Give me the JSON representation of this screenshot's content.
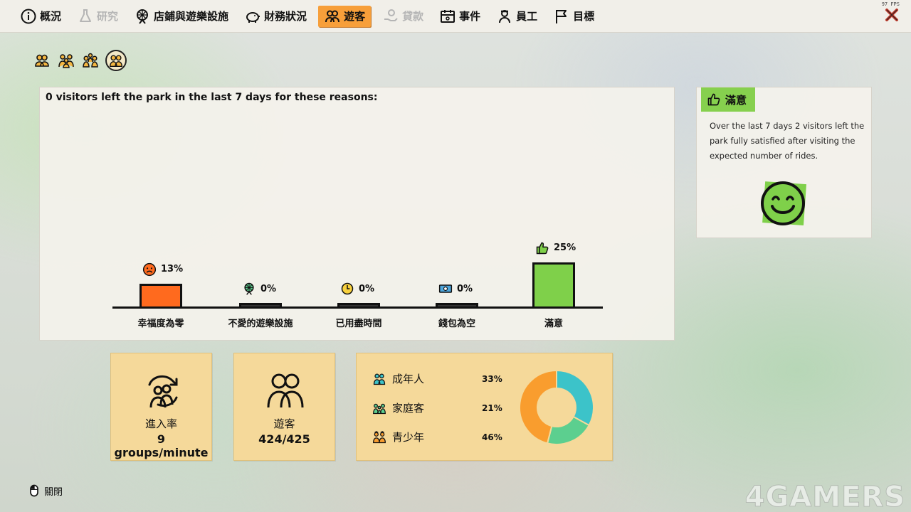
{
  "topbar": {
    "fps": "97 FPS",
    "tabs": [
      {
        "label": "概況",
        "icon": "info-icon",
        "state": "normal"
      },
      {
        "label": "研究",
        "icon": "flask-icon",
        "state": "disabled"
      },
      {
        "label": "店鋪與遊樂設施",
        "icon": "ferris-wheel-icon",
        "state": "normal"
      },
      {
        "label": "財務狀況",
        "icon": "piggy-bank-icon",
        "state": "normal"
      },
      {
        "label": "遊客",
        "icon": "visitors-icon",
        "state": "active"
      },
      {
        "label": "貸款",
        "icon": "loan-hand-icon",
        "state": "disabled"
      },
      {
        "label": "事件",
        "icon": "calendar-icon",
        "state": "normal"
      },
      {
        "label": "員工",
        "icon": "staff-icon",
        "state": "normal"
      },
      {
        "label": "目標",
        "icon": "flag-icon",
        "state": "normal"
      }
    ],
    "accent": "#f79f3a"
  },
  "subtabs": [
    "visitors-overview-icon",
    "visitors-groups-icon",
    "visitors-families-icon",
    "visitors-unhappy-icon"
  ],
  "reasons": {
    "title": "0 visitors left the park in the last 7 days for these reasons:",
    "items": [
      {
        "label": "幸福度為零",
        "percent": "13%",
        "value": 13,
        "icon": "sad-face-icon",
        "color": "#ff6a1e"
      },
      {
        "label": "不愛的遊樂設施",
        "percent": "0%",
        "value": 0,
        "icon": "ferris-wheel-icon",
        "color": "#333333"
      },
      {
        "label": "已用盡時間",
        "percent": "0%",
        "value": 0,
        "icon": "clock-icon",
        "color": "#333333"
      },
      {
        "label": "錢包為空",
        "percent": "0%",
        "value": 0,
        "icon": "money-icon",
        "color": "#333333"
      },
      {
        "label": "滿意",
        "percent": "25%",
        "value": 25,
        "icon": "thumbs-up-icon",
        "color": "#7fd04a"
      }
    ]
  },
  "satisfied": {
    "tag": "滿意",
    "description": "Over the last 7 days 2 visitors left the park fully satisfied after visiting the expected number of rides.",
    "color": "#86d04e"
  },
  "stats": {
    "entry": {
      "label": "進入率",
      "value": "9 groups/minute"
    },
    "visitors": {
      "label": "遊客",
      "value": "424/425"
    }
  },
  "demographics": {
    "rows": [
      {
        "label": "成年人",
        "percent": "33%",
        "value": 33,
        "color": "#3cc3c9",
        "icon": "adults-icon"
      },
      {
        "label": "家庭客",
        "percent": "21%",
        "value": 21,
        "color": "#5ccf8f",
        "icon": "families-icon"
      },
      {
        "label": "青少年",
        "percent": "46%",
        "value": 46,
        "color": "#f99d2e",
        "icon": "teenagers-icon"
      }
    ]
  },
  "footer": {
    "close_label": "關閉"
  },
  "watermark": "4GAMERS"
}
